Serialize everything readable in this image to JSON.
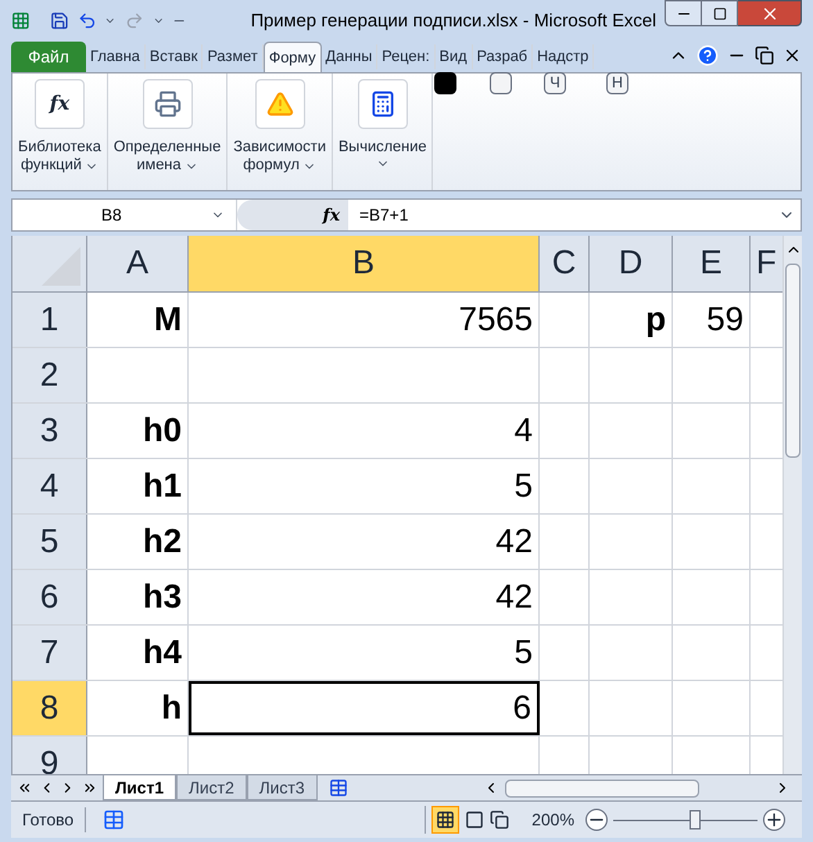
{
  "window": {
    "title": "Пример генерации подписи.xlsx  -  Microsoft Excel"
  },
  "file_tab": {
    "label": "Файл"
  },
  "tabs": [
    {
      "label": "Главна",
      "selected": false
    },
    {
      "label": "Вставк",
      "selected": false
    },
    {
      "label": "Размет",
      "selected": false
    },
    {
      "label": "Форму",
      "selected": true
    },
    {
      "label": "Данны",
      "selected": false
    },
    {
      "label": "Рецен:",
      "selected": false
    },
    {
      "label": "Вид",
      "selected": false
    },
    {
      "label": "Разраб",
      "selected": false
    },
    {
      "label": "Надстр",
      "selected": false
    }
  ],
  "keytips": [
    {
      "kind": "filled"
    },
    {
      "kind": "blank"
    },
    {
      "kind": "letter",
      "label": "Ч"
    },
    {
      "kind": "letter",
      "label": "Н"
    }
  ],
  "ribbon_groups": [
    {
      "kind": "fx",
      "icon_text": "fx",
      "label": [
        "Библиотека",
        "функций"
      ]
    },
    {
      "kind": "names",
      "label": [
        "Определенные",
        "имена"
      ]
    },
    {
      "kind": "audit",
      "label": [
        "Зависимости",
        "формул"
      ]
    },
    {
      "kind": "calc",
      "label": [
        "Вычисление"
      ]
    }
  ],
  "formula_bar": {
    "name_box": "B8",
    "fx": "fx",
    "formula": "=B7+1"
  },
  "columns": [
    {
      "label": "A",
      "selected": false
    },
    {
      "label": "B",
      "selected": true
    },
    {
      "label": "C",
      "selected": false
    },
    {
      "label": "D",
      "selected": false
    },
    {
      "label": "E",
      "selected": false
    },
    {
      "label": "F",
      "selected": false
    }
  ],
  "rows": [
    {
      "label": "1",
      "selected": false,
      "cells": [
        "M",
        "7565",
        "",
        "p",
        "59",
        ""
      ]
    },
    {
      "label": "2",
      "selected": false,
      "cells": [
        "",
        "",
        "",
        "",
        "",
        ""
      ]
    },
    {
      "label": "3",
      "selected": false,
      "cells": [
        "h0",
        "4",
        "",
        "",
        "",
        ""
      ]
    },
    {
      "label": "4",
      "selected": false,
      "cells": [
        "h1",
        "5",
        "",
        "",
        "",
        ""
      ]
    },
    {
      "label": "5",
      "selected": false,
      "cells": [
        "h2",
        "42",
        "",
        "",
        "",
        ""
      ]
    },
    {
      "label": "6",
      "selected": false,
      "cells": [
        "h3",
        "42",
        "",
        "",
        "",
        ""
      ]
    },
    {
      "label": "7",
      "selected": false,
      "cells": [
        "h4",
        "5",
        "",
        "",
        "",
        ""
      ]
    },
    {
      "label": "8",
      "selected": true,
      "cells": [
        "h",
        "6",
        "",
        "",
        "",
        ""
      ]
    },
    {
      "label": "9",
      "selected": false,
      "cells": [
        "",
        "",
        "",
        "",
        "",
        ""
      ]
    }
  ],
  "sheets": [
    {
      "label": "Лист1",
      "selected": true
    },
    {
      "label": "Лист2",
      "selected": false
    },
    {
      "label": "Лист3",
      "selected": false
    }
  ],
  "status_bar": {
    "status": "Готово",
    "zoom": "200%",
    "zoom_slider": {
      "level": 0.57
    }
  }
}
